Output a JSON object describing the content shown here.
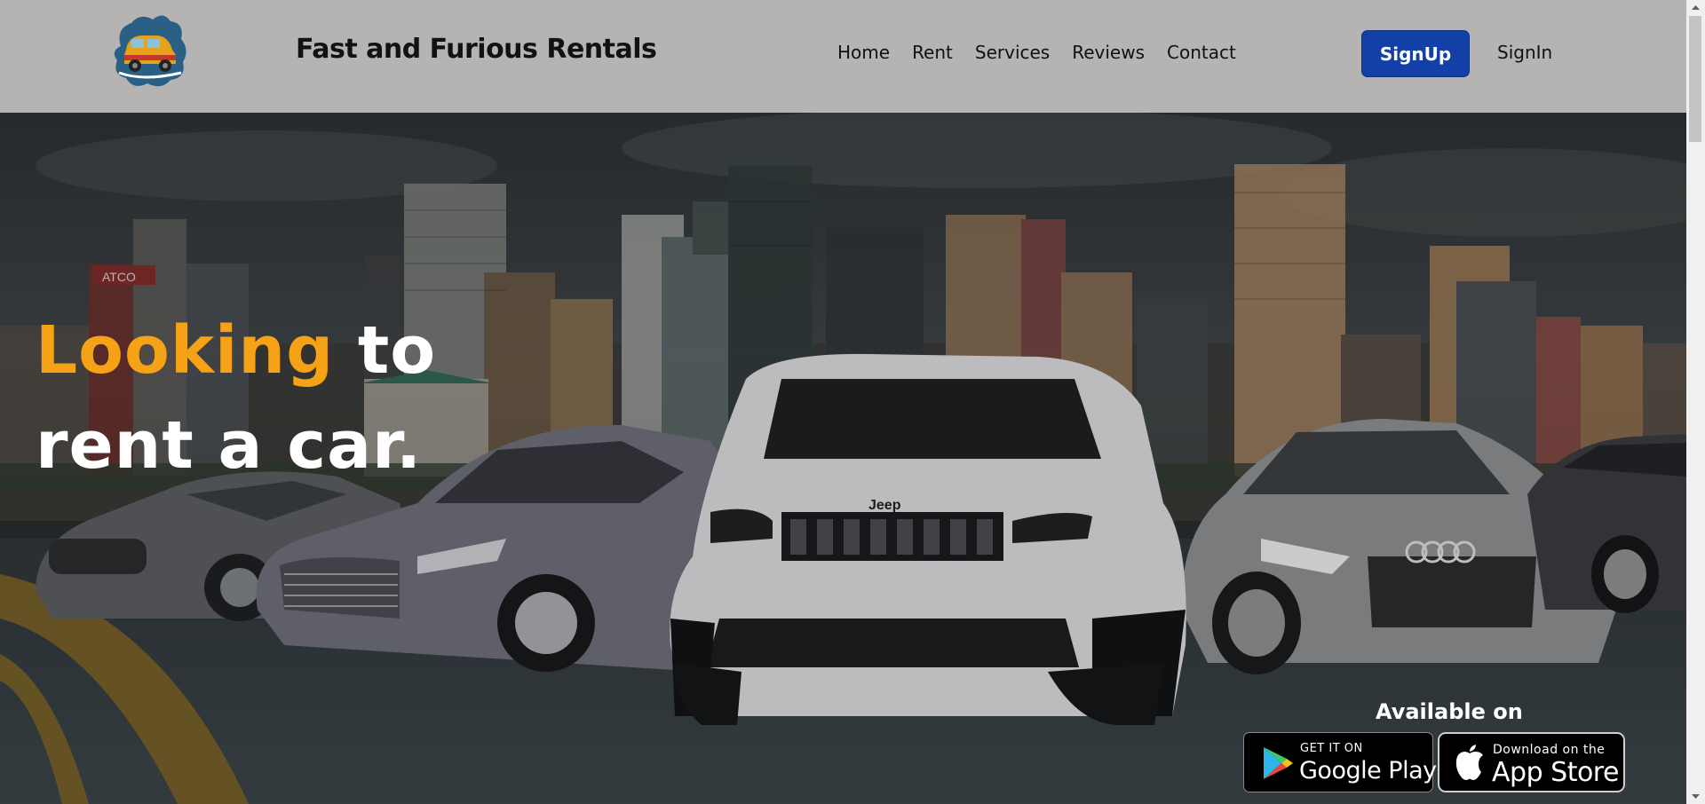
{
  "header": {
    "brand": "Fast and Furious Rentals",
    "nav": [
      "Home",
      "Rent",
      "Services",
      "Reviews",
      "Contact"
    ],
    "signup_label": "SignUp",
    "signin_label": "SignIn"
  },
  "hero": {
    "headline_accent": "Looking",
    "headline_rest1": " to",
    "headline_line2": "rent a car.",
    "jeep_badge": "Jeep",
    "billboard": "ATCO",
    "available_label": "Available on",
    "google_play": {
      "small": "GET IT ON",
      "big": "Google Play"
    },
    "app_store": {
      "small": "Download on the",
      "big": "App Store"
    }
  },
  "colors": {
    "header_bg": "#b6b3b3",
    "accent": "#f6a217",
    "signup_bg": "#1240a6"
  },
  "icons": [
    "logo-car-icon",
    "google-play-icon",
    "apple-icon",
    "scroll-up-arrow-icon",
    "scroll-down-arrow-icon"
  ]
}
